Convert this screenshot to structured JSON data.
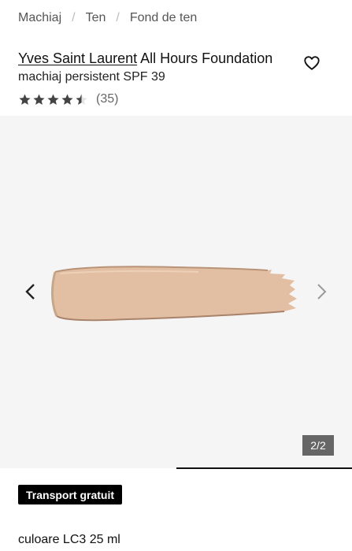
{
  "breadcrumb": [
    "Machiaj",
    "Ten",
    "Fond de ten"
  ],
  "product": {
    "brand": "Yves Saint Laurent",
    "name": "All Hours Foundation",
    "subtitle": "machiaj persistent SPF 39",
    "rating": 4.5,
    "rating_max": 5,
    "review_count": "(35)"
  },
  "gallery": {
    "counter": "2/2",
    "current_index": 2,
    "total": 2,
    "swatch_color": "#e2bfa2"
  },
  "badge": "Transport gratuit",
  "variant": "culoare LC3 25 ml",
  "icons": {
    "wishlist": "heart-outline-icon",
    "prev": "chevron-left-icon",
    "next": "chevron-right-icon",
    "star": "star-icon"
  }
}
